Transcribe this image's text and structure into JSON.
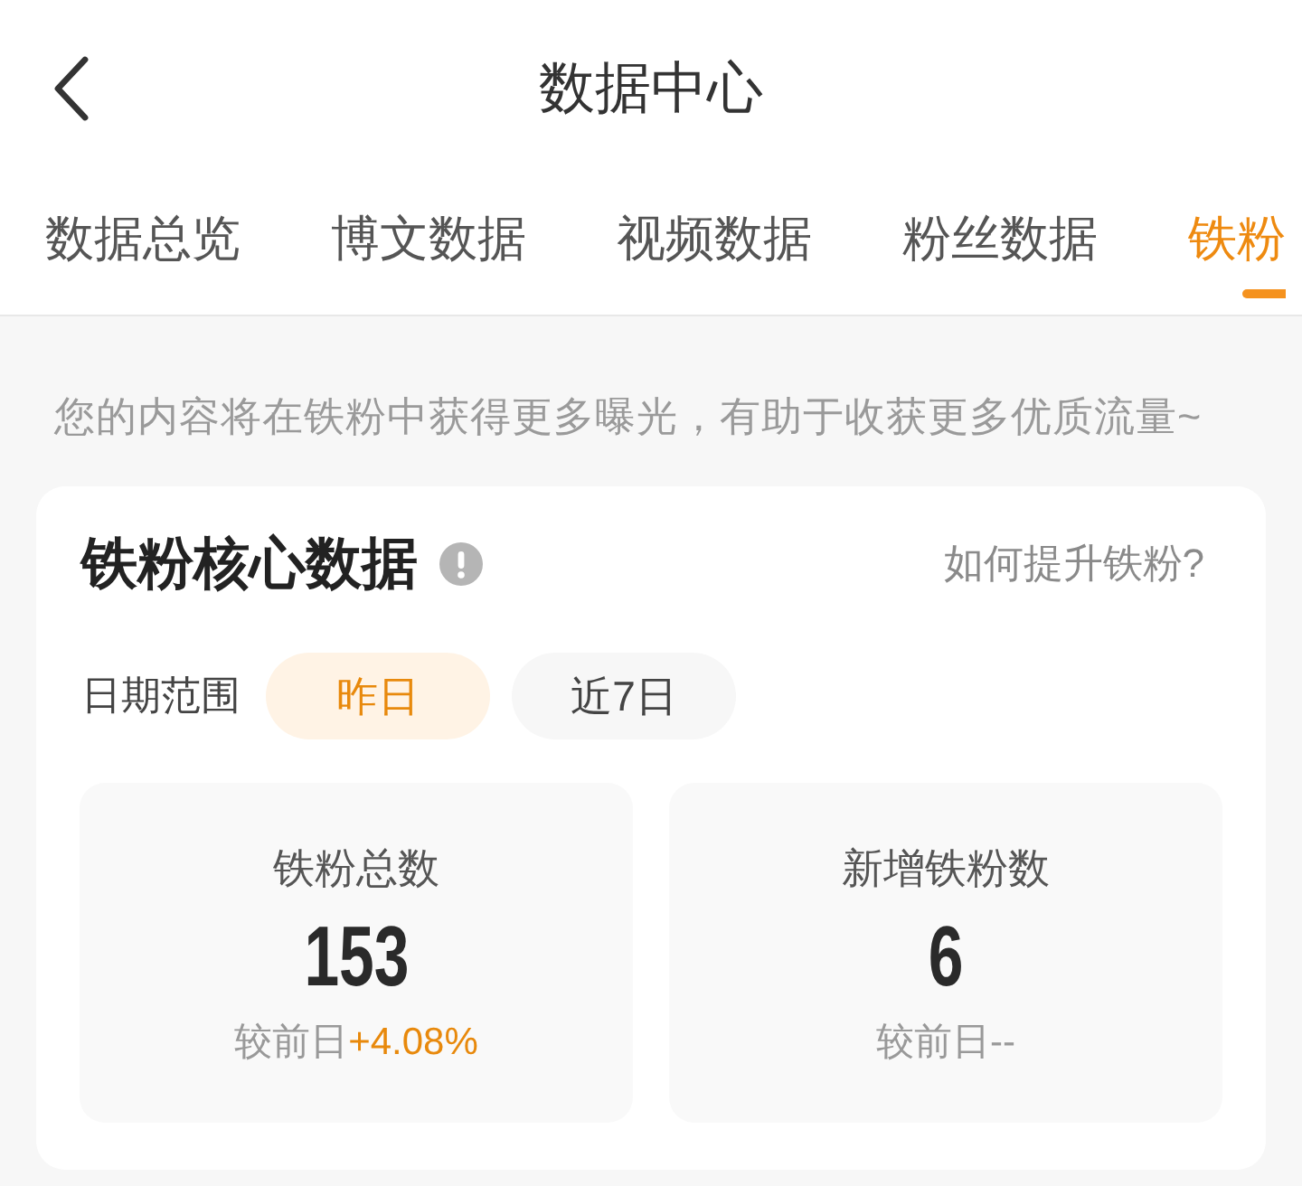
{
  "header": {
    "title": "数据中心"
  },
  "tabs": [
    {
      "label": "数据总览",
      "selected": false
    },
    {
      "label": "博文数据",
      "selected": false
    },
    {
      "label": "视频数据",
      "selected": false
    },
    {
      "label": "粉丝数据",
      "selected": false
    },
    {
      "label": "铁粉",
      "selected": true
    }
  ],
  "notice": "您的内容将在铁粉中获得更多曝光，有助于收获更多优质流量~",
  "core_card": {
    "title": "铁粉核心数据",
    "help_link": "如何提升铁粉?",
    "date_range": {
      "label": "日期范围",
      "options": [
        {
          "label": "昨日",
          "selected": true
        },
        {
          "label": "近7日",
          "selected": false
        }
      ]
    },
    "stats": [
      {
        "label": "铁粉总数",
        "value": "153",
        "compare_label": "较前日",
        "change": "+4.08%",
        "color": "#e8890c"
      },
      {
        "label": "新增铁粉数",
        "value": "6",
        "compare_label": "较前日",
        "change": "--",
        "color": "#999999"
      }
    ]
  }
}
